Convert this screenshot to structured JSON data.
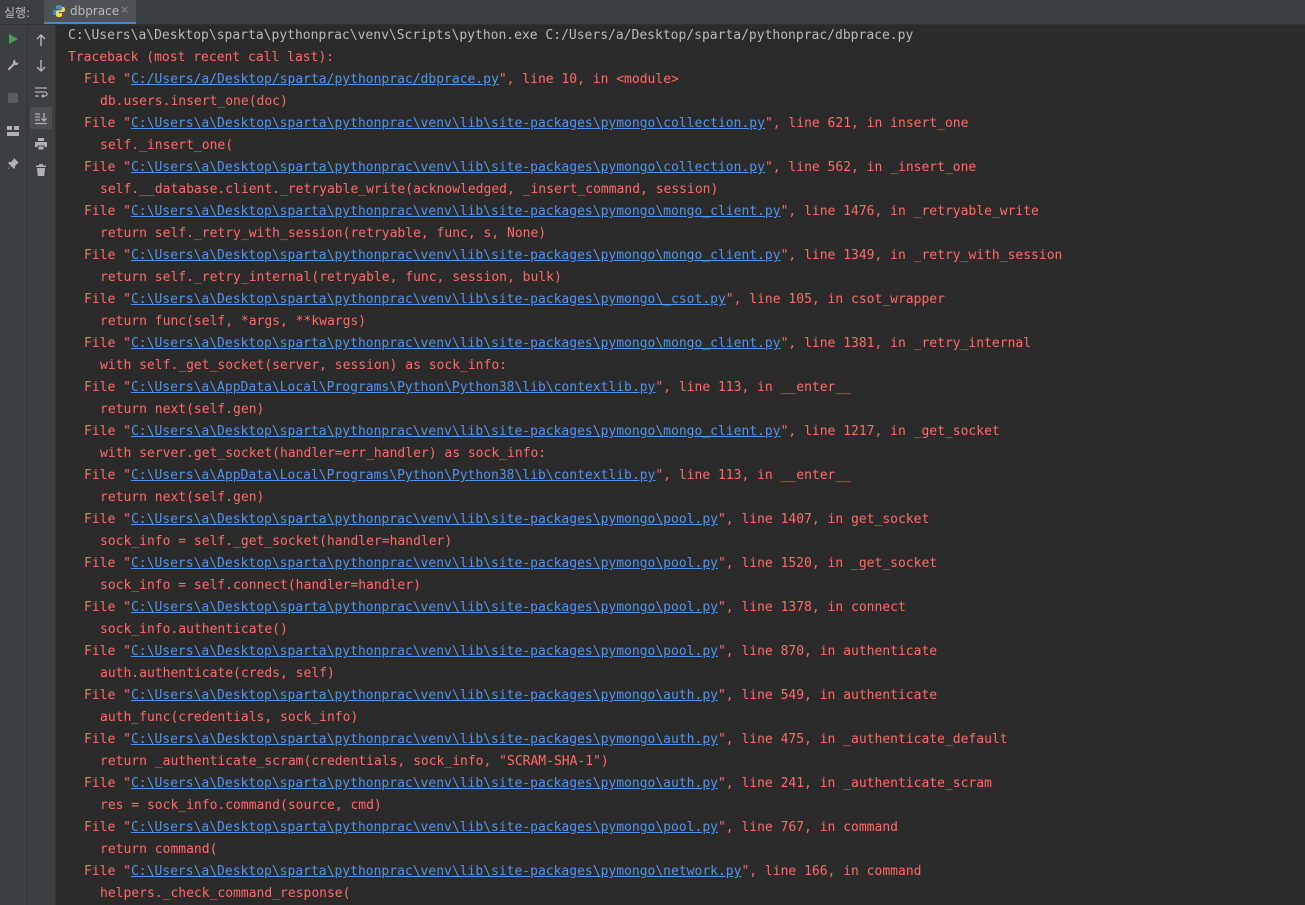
{
  "run_label": "실행:",
  "tab": {
    "title": "dbprace",
    "icon": "python-icon",
    "close_glyph": "×"
  },
  "left_toolbar": [
    {
      "name": "run-icon",
      "color": "#499c54"
    },
    {
      "name": "wrench-icon",
      "color": "#afb1b3"
    },
    {
      "name": "stop-icon",
      "color": "#5a5d5f"
    },
    {
      "name": "layout-icon",
      "color": "#afb1b3"
    },
    {
      "name": "pin-icon",
      "color": "#afb1b3"
    }
  ],
  "console_toolbar": [
    {
      "name": "up-arrow-icon"
    },
    {
      "name": "down-arrow-icon"
    },
    {
      "name": "soft-wrap-icon"
    },
    {
      "name": "scroll-to-end-icon",
      "active": true
    },
    {
      "name": "print-icon"
    },
    {
      "name": "trash-icon"
    }
  ],
  "colors": {
    "error": "#ff6b68",
    "link": "#5394ec",
    "command": "#bbbbbb",
    "background": "#2b2b2b"
  },
  "console": {
    "command": "C:\\Users\\a\\Desktop\\sparta\\pythonprac\\venv\\Scripts\\python.exe C:/Users/a/Desktop/sparta/pythonprac/dbprace.py",
    "traceback_header": "Traceback (most recent call last):",
    "frames": [
      {
        "path": "C:/Users/a/Desktop/sparta/pythonprac/dbprace.py",
        "suffix": "\", line 10, in <module>",
        "code": "db.users.insert_one(doc)"
      },
      {
        "path": "C:\\Users\\a\\Desktop\\sparta\\pythonprac\\venv\\lib\\site-packages\\pymongo\\collection.py",
        "suffix": "\", line 621, in insert_one",
        "code": "self._insert_one("
      },
      {
        "path": "C:\\Users\\a\\Desktop\\sparta\\pythonprac\\venv\\lib\\site-packages\\pymongo\\collection.py",
        "suffix": "\", line 562, in _insert_one",
        "code": "self.__database.client._retryable_write(acknowledged, _insert_command, session)"
      },
      {
        "path": "C:\\Users\\a\\Desktop\\sparta\\pythonprac\\venv\\lib\\site-packages\\pymongo\\mongo_client.py",
        "suffix": "\", line 1476, in _retryable_write",
        "code": "return self._retry_with_session(retryable, func, s, None)"
      },
      {
        "path": "C:\\Users\\a\\Desktop\\sparta\\pythonprac\\venv\\lib\\site-packages\\pymongo\\mongo_client.py",
        "suffix": "\", line 1349, in _retry_with_session",
        "code": "return self._retry_internal(retryable, func, session, bulk)"
      },
      {
        "path": "C:\\Users\\a\\Desktop\\sparta\\pythonprac\\venv\\lib\\site-packages\\pymongo\\_csot.py",
        "suffix": "\", line 105, in csot_wrapper",
        "code": "return func(self, *args, **kwargs)"
      },
      {
        "path": "C:\\Users\\a\\Desktop\\sparta\\pythonprac\\venv\\lib\\site-packages\\pymongo\\mongo_client.py",
        "suffix": "\", line 1381, in _retry_internal",
        "code": "with self._get_socket(server, session) as sock_info:"
      },
      {
        "path": "C:\\Users\\a\\AppData\\Local\\Programs\\Python\\Python38\\lib\\contextlib.py",
        "suffix": "\", line 113, in __enter__",
        "code": "return next(self.gen)"
      },
      {
        "path": "C:\\Users\\a\\Desktop\\sparta\\pythonprac\\venv\\lib\\site-packages\\pymongo\\mongo_client.py",
        "suffix": "\", line 1217, in _get_socket",
        "code": "with server.get_socket(handler=err_handler) as sock_info:"
      },
      {
        "path": "C:\\Users\\a\\AppData\\Local\\Programs\\Python\\Python38\\lib\\contextlib.py",
        "suffix": "\", line 113, in __enter__",
        "code": "return next(self.gen)"
      },
      {
        "path": "C:\\Users\\a\\Desktop\\sparta\\pythonprac\\venv\\lib\\site-packages\\pymongo\\pool.py",
        "suffix": "\", line 1407, in get_socket",
        "code": "sock_info = self._get_socket(handler=handler)"
      },
      {
        "path": "C:\\Users\\a\\Desktop\\sparta\\pythonprac\\venv\\lib\\site-packages\\pymongo\\pool.py",
        "suffix": "\", line 1520, in _get_socket",
        "code": "sock_info = self.connect(handler=handler)"
      },
      {
        "path": "C:\\Users\\a\\Desktop\\sparta\\pythonprac\\venv\\lib\\site-packages\\pymongo\\pool.py",
        "suffix": "\", line 1378, in connect",
        "code": "sock_info.authenticate()"
      },
      {
        "path": "C:\\Users\\a\\Desktop\\sparta\\pythonprac\\venv\\lib\\site-packages\\pymongo\\pool.py",
        "suffix": "\", line 870, in authenticate",
        "code": "auth.authenticate(creds, self)"
      },
      {
        "path": "C:\\Users\\a\\Desktop\\sparta\\pythonprac\\venv\\lib\\site-packages\\pymongo\\auth.py",
        "suffix": "\", line 549, in authenticate",
        "code": "auth_func(credentials, sock_info)"
      },
      {
        "path": "C:\\Users\\a\\Desktop\\sparta\\pythonprac\\venv\\lib\\site-packages\\pymongo\\auth.py",
        "suffix": "\", line 475, in _authenticate_default",
        "code": "return _authenticate_scram(credentials, sock_info, \"SCRAM-SHA-1\")"
      },
      {
        "path": "C:\\Users\\a\\Desktop\\sparta\\pythonprac\\venv\\lib\\site-packages\\pymongo\\auth.py",
        "suffix": "\", line 241, in _authenticate_scram",
        "code": "res = sock_info.command(source, cmd)"
      },
      {
        "path": "C:\\Users\\a\\Desktop\\sparta\\pythonprac\\venv\\lib\\site-packages\\pymongo\\pool.py",
        "suffix": "\", line 767, in command",
        "code": "return command("
      },
      {
        "path": "C:\\Users\\a\\Desktop\\sparta\\pythonprac\\venv\\lib\\site-packages\\pymongo\\network.py",
        "suffix": "\", line 166, in command",
        "code": "helpers._check_command_response("
      }
    ]
  }
}
